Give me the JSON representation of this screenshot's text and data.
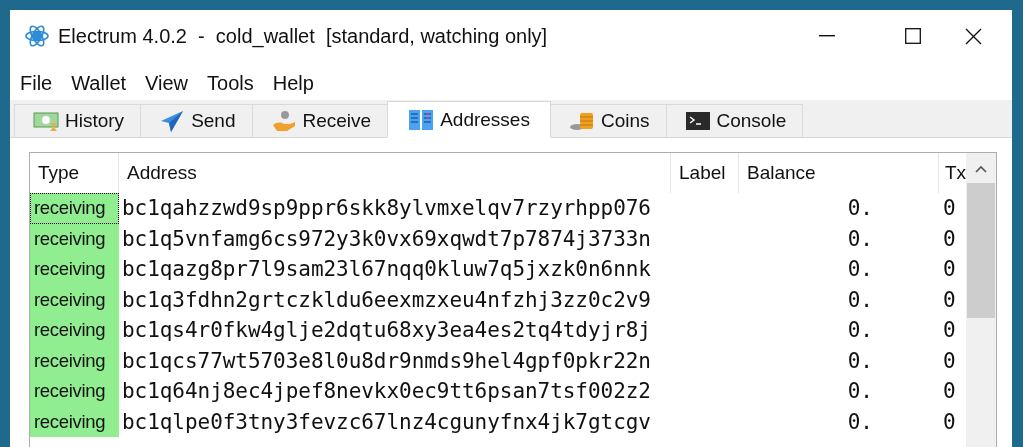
{
  "window": {
    "title": "Electrum 4.0.2  -  cold_wallet  [standard, watching only]"
  },
  "menu": [
    "File",
    "Wallet",
    "View",
    "Tools",
    "Help"
  ],
  "tabs": [
    {
      "label": "History",
      "selected": false
    },
    {
      "label": "Send",
      "selected": false
    },
    {
      "label": "Receive",
      "selected": false
    },
    {
      "label": "Addresses",
      "selected": true
    },
    {
      "label": "Coins",
      "selected": false
    },
    {
      "label": "Console",
      "selected": false
    }
  ],
  "table": {
    "columns": [
      "Type",
      "Address",
      "Label",
      "Balance",
      "Tx"
    ],
    "rows": [
      {
        "type": "receiving",
        "address": "bc1qahzzwd9sp9ppr6skk8ylvmxelqv7rzyrhpp076",
        "balance": "0.",
        "tx": "0",
        "focused": true
      },
      {
        "type": "receiving",
        "address": "bc1q5vnfamg6cs972y3k0vx69xqwdt7p7874j3733n",
        "balance": "0.",
        "tx": "0",
        "focused": false
      },
      {
        "type": "receiving",
        "address": "bc1qazg8pr7l9sam23l67nqq0kluw7q5jxzk0n6nnk",
        "balance": "0.",
        "tx": "0",
        "focused": false
      },
      {
        "type": "receiving",
        "address": "bc1q3fdhn2grtczkldu6eexmzxeu4nfzhj3zz0c2v9",
        "balance": "0.",
        "tx": "0",
        "focused": false
      },
      {
        "type": "receiving",
        "address": "bc1qs4r0fkw4glje2dqtu68xy3ea4es2tq4tdyjr8j",
        "balance": "0.",
        "tx": "0",
        "focused": false
      },
      {
        "type": "receiving",
        "address": "bc1qcs77wt5703e8l0u8dr9nmds9hel4gpf0pkr22n",
        "balance": "0.",
        "tx": "0",
        "focused": false
      },
      {
        "type": "receiving",
        "address": "bc1q64nj8ec4jpef8nevkx0ec9tt6psan7tsf002z2",
        "balance": "0.",
        "tx": "0",
        "focused": false
      },
      {
        "type": "receiving",
        "address": "bc1qlpe0f3tny3fevzc67lnz4cgunyfnx4jk7gtcgv",
        "balance": "0.",
        "tx": "0",
        "focused": false
      }
    ]
  }
}
